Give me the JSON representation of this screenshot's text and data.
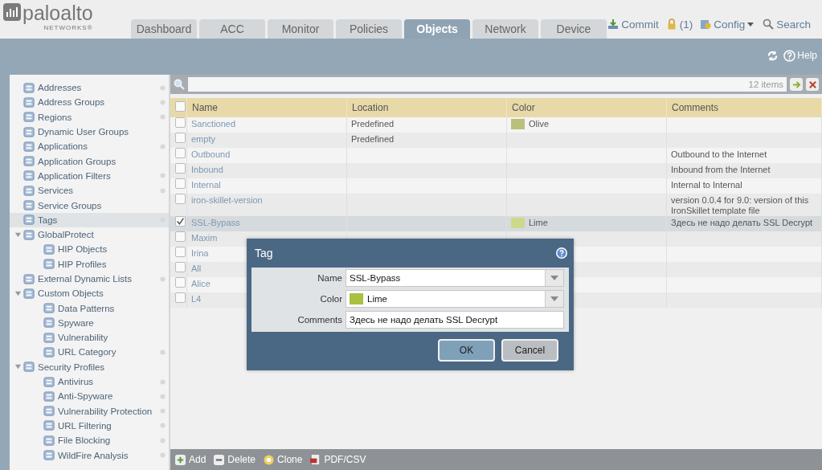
{
  "logo": {
    "name": "paloalto",
    "sub": "NETWORKS®"
  },
  "tabs": [
    {
      "label": "Dashboard",
      "selected": false
    },
    {
      "label": "ACC",
      "selected": false
    },
    {
      "label": "Monitor",
      "selected": false
    },
    {
      "label": "Policies",
      "selected": false
    },
    {
      "label": "Objects",
      "selected": true
    },
    {
      "label": "Network",
      "selected": false
    },
    {
      "label": "Device",
      "selected": false
    }
  ],
  "top_actions": {
    "commit": "Commit",
    "lock_count": "(1)",
    "config": "Config",
    "search": "Search"
  },
  "help": "Help",
  "sidebar": {
    "items": [
      {
        "label": "Addresses",
        "dot": true,
        "selected": false
      },
      {
        "label": "Address Groups",
        "dot": true,
        "selected": false
      },
      {
        "label": "Regions",
        "dot": true,
        "selected": false
      },
      {
        "label": "Dynamic User Groups",
        "dot": false,
        "selected": false
      },
      {
        "label": "Applications",
        "dot": true,
        "selected": false
      },
      {
        "label": "Application Groups",
        "dot": false,
        "selected": false
      },
      {
        "label": "Application Filters",
        "dot": true,
        "selected": false
      },
      {
        "label": "Services",
        "dot": true,
        "selected": false
      },
      {
        "label": "Service Groups",
        "dot": false,
        "selected": false
      },
      {
        "label": "Tags",
        "dot": true,
        "selected": true
      },
      {
        "label": "GlobalProtect",
        "dot": false,
        "selected": false,
        "expanded": true,
        "children": [
          {
            "label": "HIP Objects",
            "dot": false,
            "selected": false
          },
          {
            "label": "HIP Profiles",
            "dot": false,
            "selected": false
          }
        ]
      },
      {
        "label": "External Dynamic Lists",
        "dot": true,
        "selected": false
      },
      {
        "label": "Custom Objects",
        "dot": false,
        "selected": false,
        "expanded": true,
        "children": [
          {
            "label": "Data Patterns",
            "dot": false,
            "selected": false
          },
          {
            "label": "Spyware",
            "dot": false,
            "selected": false
          },
          {
            "label": "Vulnerability",
            "dot": false,
            "selected": false
          },
          {
            "label": "URL Category",
            "dot": true,
            "selected": false
          }
        ]
      },
      {
        "label": "Security Profiles",
        "dot": false,
        "selected": false,
        "expanded": true,
        "children": [
          {
            "label": "Antivirus",
            "dot": true,
            "selected": false
          },
          {
            "label": "Anti-Spyware",
            "dot": true,
            "selected": false
          },
          {
            "label": "Vulnerability Protection",
            "dot": true,
            "selected": false
          },
          {
            "label": "URL Filtering",
            "dot": true,
            "selected": false
          },
          {
            "label": "File Blocking",
            "dot": true,
            "selected": false
          },
          {
            "label": "WildFire Analysis",
            "dot": true,
            "selected": false
          }
        ]
      }
    ]
  },
  "filter": {
    "count": "12 items"
  },
  "table": {
    "all_checked": false,
    "columns": [
      "Name",
      "Location",
      "Color",
      "Comments"
    ],
    "rows": [
      {
        "name": "Sanctioned",
        "location": "Predefined",
        "color_name": "Olive",
        "color": "#b8c07a",
        "comments": "",
        "checked": false,
        "selected": false
      },
      {
        "name": "empty",
        "location": "Predefined",
        "color_name": "",
        "comments": "",
        "checked": false,
        "selected": false
      },
      {
        "name": "Outbound",
        "location": "",
        "color_name": "",
        "comments": "Outbound to the Internet",
        "checked": false,
        "selected": false
      },
      {
        "name": "Inbound",
        "location": "",
        "color_name": "",
        "comments": "Inbound from the Internet",
        "checked": false,
        "selected": false
      },
      {
        "name": "Internal",
        "location": "",
        "color_name": "",
        "comments": "Internal to Internal",
        "checked": false,
        "selected": false
      },
      {
        "name": "iron-skillet-version",
        "location": "",
        "color_name": "",
        "comments": "version 0.0.4 for 9.0: version of this IronSkillet template file",
        "checked": false,
        "selected": false
      },
      {
        "name": "SSL-Bypass",
        "location": "",
        "color_name": "Lime",
        "color": "#cdd98a",
        "comments": "Здесь не надо делать SSL Decrypt",
        "checked": true,
        "selected": true
      },
      {
        "name": "Maxim",
        "location": "",
        "color_name": "",
        "comments": "",
        "checked": false,
        "selected": false
      },
      {
        "name": "Irina",
        "location": "",
        "color_name": "",
        "comments": "",
        "checked": false,
        "selected": false
      },
      {
        "name": "All",
        "location": "",
        "color_name": "",
        "comments": "",
        "checked": false,
        "selected": false
      },
      {
        "name": "Alice",
        "location": "",
        "color_name": "",
        "comments": "",
        "checked": false,
        "selected": false
      },
      {
        "name": "L4",
        "location": "",
        "color_name": "",
        "comments": "",
        "checked": false,
        "selected": false
      }
    ]
  },
  "footer_actions": [
    {
      "label": "Add",
      "kind": "add"
    },
    {
      "label": "Delete",
      "kind": "delete"
    },
    {
      "label": "Clone",
      "kind": "clone"
    },
    {
      "label": "PDF/CSV",
      "kind": "pdf"
    }
  ],
  "dialog": {
    "title": "Tag",
    "fields": [
      {
        "label": "Name",
        "value": "SSL-Bypass",
        "kind": "combo"
      },
      {
        "label": "Color",
        "value": "Lime",
        "color": "#a9c040",
        "kind": "color"
      },
      {
        "label": "Comments",
        "value": "Здесь не надо делать SSL Decrypt",
        "kind": "text"
      }
    ],
    "buttons": [
      {
        "label": "OK",
        "kind": "primary"
      },
      {
        "label": "Cancel",
        "kind": "secondary"
      }
    ]
  }
}
